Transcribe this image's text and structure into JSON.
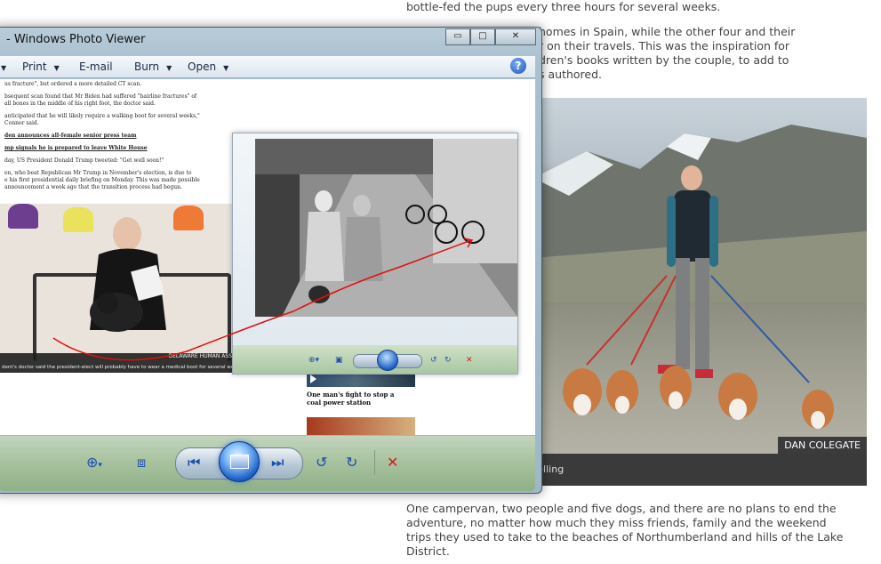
{
  "article": {
    "para1": "bottle-fed the pups every three hours for several weeks.",
    "para2": "homes in Spain, while the other four and their\nr on their travels. This was the inspiration for\ndren's books written by the couple, to add to\ns authored.",
    "para3": "One campervan, two people and five dogs, and there are no plans to end the\nadventure, no matter how much they miss friends, family and the weekend\ntrips they used to take to the beaches of Northumberland and hills of the Lake\nDistrict.",
    "photo_credit": "DAN COLEGATE",
    "photo_caption_partial": "relling"
  },
  "window": {
    "title": "- Windows Photo Viewer",
    "caption_buttons": {
      "minimize": "▭",
      "maximize": "□",
      "close": "✕"
    },
    "menu": [
      {
        "label": "Print"
      },
      {
        "label": "E-mail"
      },
      {
        "label": "Burn"
      },
      {
        "label": "Open"
      }
    ],
    "help_label": "?"
  },
  "news": {
    "line1": "us fracture\", but ordered a more detailed CT scan.",
    "line2": "bsequent scan found that Mr Biden had suffered \"hairline fractures\" of",
    "line3": "all bones in the middle of his right foot, the doctor said.",
    "line4": "anticipated that he will likely require a walking boot for several weeks,\"",
    "line5": "Connor said.",
    "link1": "den announces all-female senior press team",
    "link2": "mp signals he is prepared to leave White House",
    "line6": "day, US President Donald Trump tweeted: \"Get well soon!\"",
    "line7": "en, who beat Republican Mr Trump in November's election, is due to",
    "line8": "e his first presidential daily briefing on Monday. This was made possible",
    "line9": "announcement a week ago that the transition process had begun.",
    "image_source": "DELAWARE HUMAN ASSOCIATION",
    "image_caption": "dent's doctor said the president-elect will probably have to wear a medical boot for several weeks",
    "sidebar_story": "One man's fight to stop a coal power station"
  },
  "colors": {
    "annotation": "#e01010",
    "toolbar_icon": "#1d4fae",
    "delete_icon": "#d41a1a"
  },
  "toolbar_icons": [
    "zoom-icon",
    "fit-to-window-icon",
    "previous-icon",
    "slideshow-icon",
    "next-icon",
    "rotate-left-icon",
    "rotate-right-icon",
    "delete-icon"
  ]
}
